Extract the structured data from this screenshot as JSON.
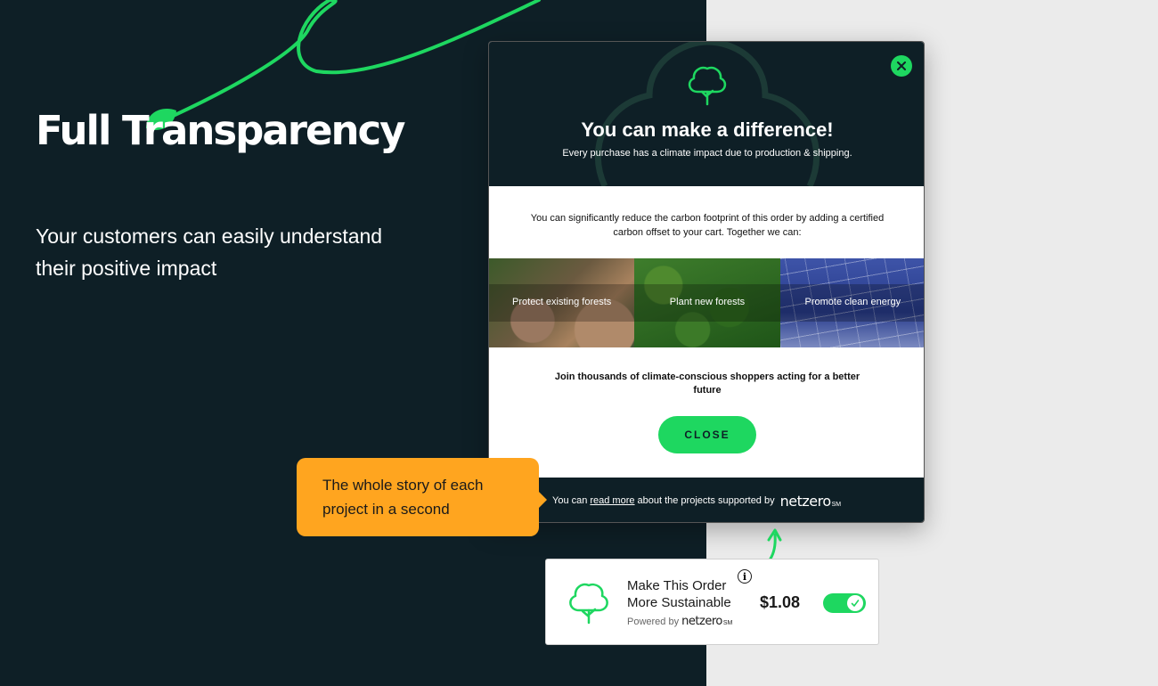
{
  "hero": {
    "title": "Full Transparency",
    "subtitle": "Your customers can easily understand their positive impact"
  },
  "modal": {
    "title": "You can make a difference!",
    "subtitle": "Every purchase has a climate impact due to production & shipping.",
    "description": "You can significantly reduce the carbon footprint of this order by adding a certified carbon offset to your cart. Together we can:",
    "tiles": [
      {
        "label": "Protect existing forests"
      },
      {
        "label": "Plant new forests"
      },
      {
        "label": "Promote clean energy"
      }
    ],
    "join_text": "Join thousands of climate-conscious shoppers acting for a better future",
    "close_button": "CLOSE",
    "footer": {
      "prefix": "You can",
      "link": "read more",
      "suffix": "about the projects supported by"
    }
  },
  "brand": {
    "name": "netzero",
    "mark": "SM"
  },
  "tooltip": {
    "text": "The whole story of each project in a second"
  },
  "widget": {
    "title": "Make This Order More Sustainable",
    "info_icon": "i",
    "powered_by": "Powered by",
    "price": "$1.08",
    "toggle_on": true
  },
  "colors": {
    "dark_bg": "#0e1f26",
    "accent_green": "#1ed760",
    "tooltip_orange": "#ffa51f",
    "light_bg": "#ebebeb"
  },
  "icons": [
    "tree-icon",
    "close-icon",
    "info-icon",
    "check-icon",
    "leaf-icon",
    "arrow-icon"
  ]
}
